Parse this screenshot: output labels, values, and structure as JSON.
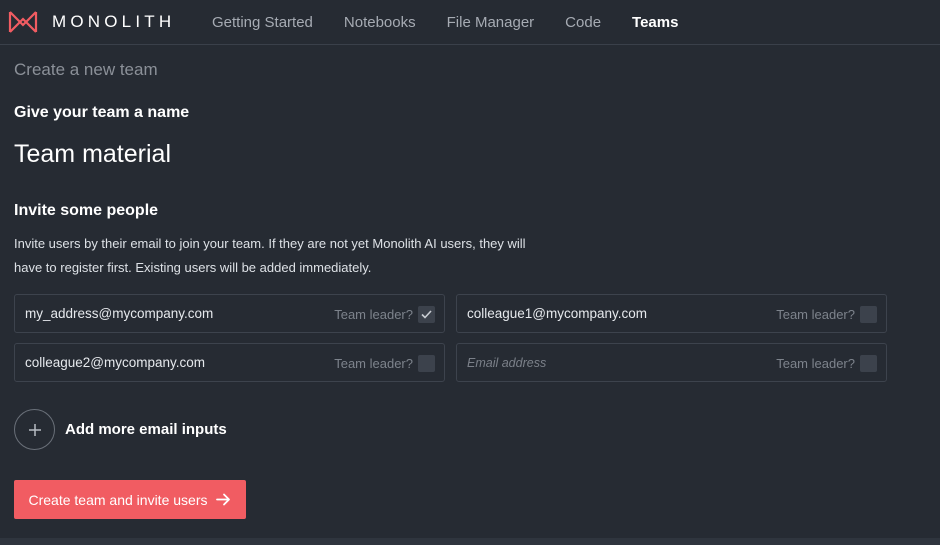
{
  "app": {
    "logo_text": "MONOLITH",
    "brand_color": "#f15c62"
  },
  "nav": [
    {
      "label": "Getting Started",
      "active": false
    },
    {
      "label": "Notebooks",
      "active": false
    },
    {
      "label": "File Manager",
      "active": false
    },
    {
      "label": "Code",
      "active": false
    },
    {
      "label": "Teams",
      "active": true
    }
  ],
  "page": {
    "title": "Create a new team",
    "name_heading": "Give your team a name",
    "team_name": "Team material",
    "invite_heading": "Invite some people",
    "invite_desc_line1": "Invite users by their email to join your team. If they are not yet Monolith AI users, they will",
    "invite_desc_line2": "have to register first. Existing users will be added immediately."
  },
  "invites": [
    {
      "email": "my_address@mycompany.com",
      "placeholder": "",
      "leader_label": "Team leader?",
      "leader_checked": true
    },
    {
      "email": "colleague1@mycompany.com",
      "placeholder": "",
      "leader_label": "Team leader?",
      "leader_checked": false
    },
    {
      "email": "colleague2@mycompany.com",
      "placeholder": "",
      "leader_label": "Team leader?",
      "leader_checked": false
    },
    {
      "email": "",
      "placeholder": "Email address",
      "leader_label": "Team leader?",
      "leader_checked": false
    }
  ],
  "actions": {
    "add_icon": "plus-icon",
    "add_label": "Add more email inputs",
    "submit_label": "Create team and invite users",
    "submit_icon": "arrow-right-icon"
  }
}
